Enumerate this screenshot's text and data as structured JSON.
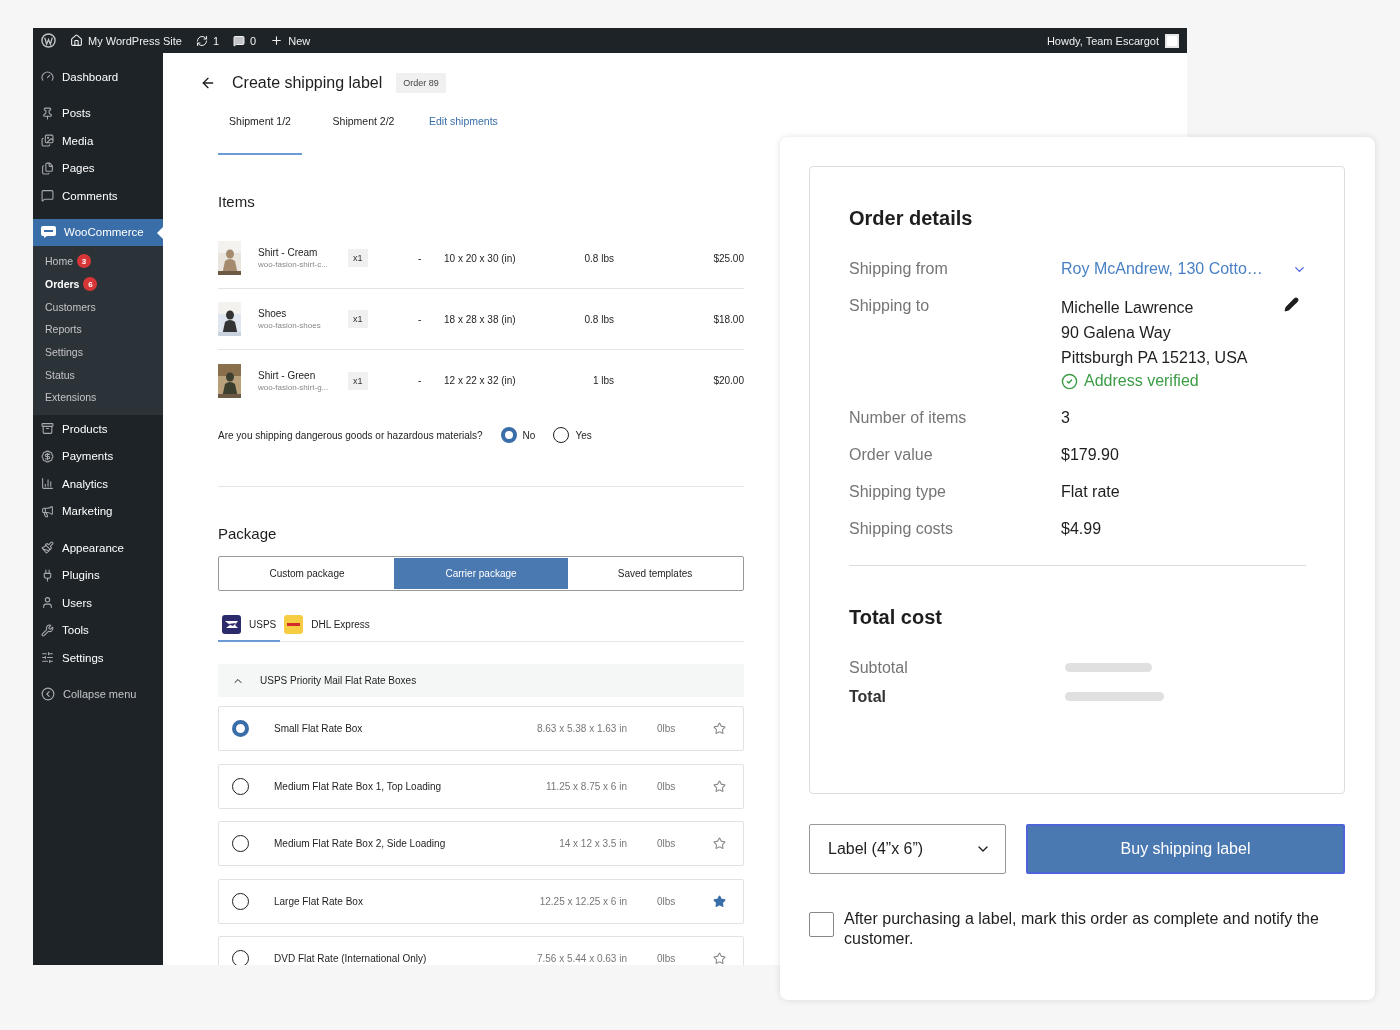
{
  "admin_bar": {
    "site": "My WordPress Site",
    "updates": "1",
    "comments": "0",
    "new": "New",
    "greeting": "Howdy, Team Escargot"
  },
  "sidebar": {
    "groups": [
      [
        {
          "label": "Dashboard",
          "selected": false
        }
      ],
      [
        {
          "label": "Posts",
          "selected": false
        },
        {
          "label": "Media",
          "selected": false
        },
        {
          "label": "Pages",
          "selected": false
        },
        {
          "label": "Comments",
          "selected": false
        }
      ],
      [
        {
          "label": "WooCommerce",
          "selected": true,
          "children": [
            {
              "label": "Home",
              "badge": "3",
              "selected": false
            },
            {
              "label": "Orders",
              "badge": "6",
              "selected": true
            },
            {
              "label": "Customers",
              "selected": false
            },
            {
              "label": "Reports",
              "selected": false
            },
            {
              "label": "Settings",
              "selected": false
            },
            {
              "label": "Status",
              "selected": false
            },
            {
              "label": "Extensions",
              "selected": false
            }
          ]
        },
        {
          "label": "Products",
          "selected": false
        },
        {
          "label": "Payments",
          "selected": false
        },
        {
          "label": "Analytics",
          "selected": false
        },
        {
          "label": "Marketing",
          "selected": false
        }
      ],
      [
        {
          "label": "Appearance",
          "selected": false
        },
        {
          "label": "Plugins",
          "selected": false
        },
        {
          "label": "Users",
          "selected": false
        },
        {
          "label": "Tools",
          "selected": false
        },
        {
          "label": "Settings",
          "selected": false
        }
      ]
    ],
    "collapse": "Collapse menu"
  },
  "header": {
    "title": "Create shipping label",
    "order_badge": "Order 89"
  },
  "tabs": [
    {
      "label": "Shipment 1/2",
      "selected": true
    },
    {
      "label": "Shipment 2/2",
      "selected": false
    }
  ],
  "edit_link": "Edit shipments",
  "items": {
    "heading": "Items",
    "rows": [
      {
        "name": "Shirt - Cream",
        "sku": "woo-fasion-shirt-c...",
        "qty": "x1",
        "dash": "-",
        "dims": "10 x 20 x 30 (in)",
        "weight": "0.8 lbs",
        "price": "$25.00"
      },
      {
        "name": "Shoes",
        "sku": "woo-fasion-shoes",
        "qty": "x1",
        "dash": "-",
        "dims": "18 x 28 x 38 (in)",
        "weight": "0.8 lbs",
        "price": "$18.00"
      },
      {
        "name": "Shirt - Green",
        "sku": "woo-fasion-shirt-g...",
        "qty": "x1",
        "dash": "-",
        "dims": "12 x 22 x 32 (in)",
        "weight": "1 lbs",
        "price": "$20.00"
      }
    ]
  },
  "hazard": {
    "question": "Are you shipping dangerous goods or hazardous materials?",
    "options": [
      {
        "label": "No",
        "selected": true
      },
      {
        "label": "Yes",
        "selected": false
      }
    ]
  },
  "package": {
    "heading": "Package",
    "modes": [
      {
        "label": "Custom package",
        "selected": false
      },
      {
        "label": "Carrier package",
        "selected": true
      },
      {
        "label": "Saved templates",
        "selected": false
      }
    ],
    "carriers": [
      {
        "label": "USPS",
        "selected": true
      },
      {
        "label": "DHL Express",
        "selected": false
      }
    ],
    "group": {
      "title": "USPS Priority Mail Flat Rate Boxes",
      "expanded": true
    },
    "boxes": [
      {
        "name": "Small Flat Rate Box",
        "dims": "8.63 x 5.38 x 1.63 in",
        "weight": "0lbs",
        "selected": true,
        "starred": false
      },
      {
        "name": "Medium Flat Rate Box 1, Top Loading",
        "dims": "11.25 x 8.75 x 6 in",
        "weight": "0lbs",
        "selected": false,
        "starred": false
      },
      {
        "name": "Medium Flat Rate Box 2, Side Loading",
        "dims": "14 x 12 x 3.5 in",
        "weight": "0lbs",
        "selected": false,
        "starred": false
      },
      {
        "name": "Large Flat Rate Box",
        "dims": "12.25 x 12.25 x 6 in",
        "weight": "0lbs",
        "selected": false,
        "starred": true
      },
      {
        "name": "DVD Flat Rate (International Only)",
        "dims": "7.56 x 5.44 x 0.63 in",
        "weight": "0lbs",
        "selected": false,
        "starred": false
      }
    ]
  },
  "order": {
    "heading": "Order details",
    "rows": [
      {
        "kind": "select",
        "label": "Shipping from",
        "value": "Roy McAndrew, 130 Cotto…"
      },
      {
        "kind": "address",
        "label": "Shipping to",
        "lines": [
          "Michelle Lawrence",
          "90 Galena Way",
          "Pittsburgh PA 15213, USA"
        ],
        "verified": "Address verified"
      },
      {
        "kind": "text",
        "label": "Number of items",
        "value": "3"
      },
      {
        "kind": "text",
        "label": "Order value",
        "value": "$179.90"
      },
      {
        "kind": "text",
        "label": "Shipping type",
        "value": "Flat rate"
      },
      {
        "kind": "text",
        "label": "Shipping costs",
        "value": "$4.99"
      }
    ],
    "total": {
      "heading": "Total cost",
      "rows": [
        {
          "kind": "subtotal",
          "label": "Subtotal"
        },
        {
          "kind": "total",
          "label": "Total"
        }
      ]
    }
  },
  "label_size": "Label (4”x 6”)",
  "buy_button": "Buy shipping label",
  "complete_option": {
    "text": "After purchasing a label, mark this order as complete and notify the customer.",
    "checked": false
  }
}
